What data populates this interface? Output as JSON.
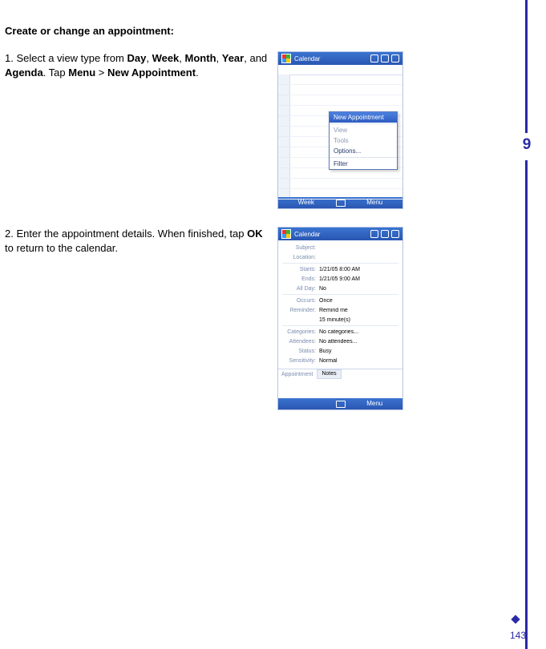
{
  "chapter": {
    "number": "9"
  },
  "page": {
    "number": "143"
  },
  "heading": "Create or change an appointment:",
  "step1": {
    "num": "1.",
    "pre": "Select a view type from ",
    "b1": "Day",
    "c1": ", ",
    "b2": "Week",
    "c2": ", ",
    "b3": "Month",
    "c3": ", ",
    "b4": "Year",
    "c4": ", and ",
    "b5": "Agenda",
    "c5": ". Tap ",
    "b6": "Menu",
    "c6": " > ",
    "b7": "New Appointment",
    "c7": "."
  },
  "step2": {
    "num": "2.",
    "pre": "Enter the appointment details. When finished, tap ",
    "b1": "OK",
    "post": " to return to the calendar."
  },
  "shot1": {
    "title": "Calendar",
    "soft_left": "Week",
    "soft_right": "Menu",
    "popup_header": "New Appointment",
    "popup_items": [
      "View",
      "Tools",
      "Options...",
      "Filter"
    ]
  },
  "shot2": {
    "title": "Calendar",
    "tab_active": "Appointment",
    "tab_other": "Notes",
    "rows": {
      "subject": {
        "label": "Subject:",
        "value": ""
      },
      "location": {
        "label": "Location:",
        "value": ""
      },
      "starts": {
        "label": "Starts:",
        "value": "1/21/05   8:00 AM"
      },
      "ends": {
        "label": "Ends:",
        "value": "1/21/05   9:00 AM"
      },
      "allday": {
        "label": "All Day:",
        "value": "No"
      },
      "occurs": {
        "label": "Occurs:",
        "value": "Once"
      },
      "reminder": {
        "label": "Reminder:",
        "value": "15 minute(s)"
      },
      "reminder2": {
        "label": "",
        "value": "Remind me"
      },
      "categories": {
        "label": "Categories:",
        "value": "No categories..."
      },
      "attendees": {
        "label": "Attendees:",
        "value": "No attendees..."
      },
      "status": {
        "label": "Status:",
        "value": "Busy"
      },
      "sensitivity": {
        "label": "Sensitivity:",
        "value": "Normal"
      }
    },
    "notes_label": "Appointment",
    "notes_btn": "Notes",
    "soft_left": "",
    "soft_right": "Menu"
  }
}
